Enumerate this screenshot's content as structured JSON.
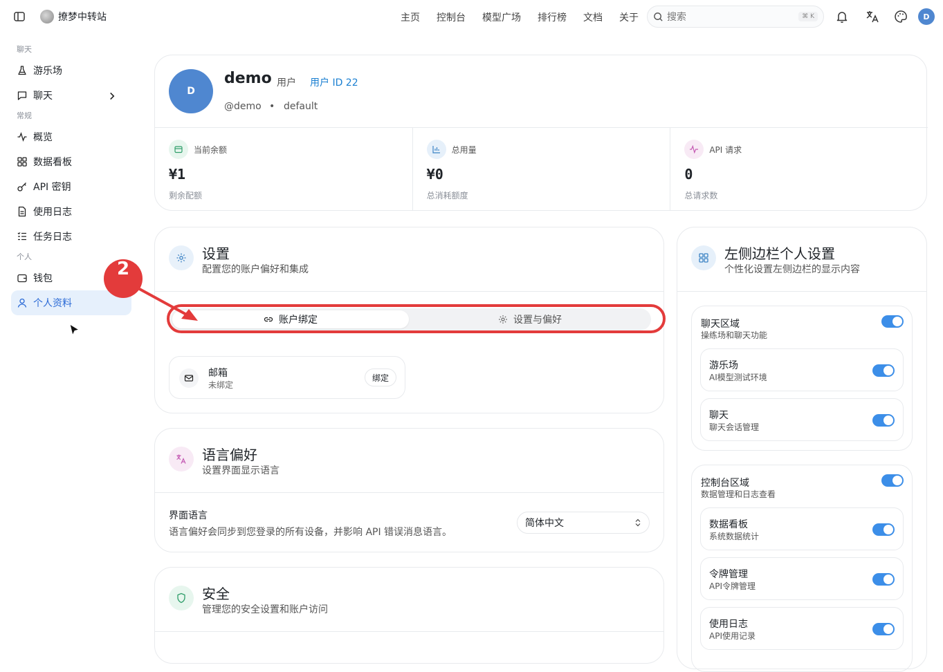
{
  "header": {
    "site_name": "撩梦中转站",
    "nav": [
      "主页",
      "控制台",
      "模型广场",
      "排行榜",
      "文档",
      "关于"
    ],
    "search_placeholder": "搜索",
    "search_shortcut": "⌘ K",
    "avatar_initial": "D"
  },
  "sidebar": {
    "groups": [
      {
        "label": "聊天",
        "items": [
          {
            "label": "游乐场",
            "icon": "flask-icon"
          },
          {
            "label": "聊天",
            "icon": "message-icon",
            "has_chevron": true
          }
        ]
      },
      {
        "label": "常规",
        "items": [
          {
            "label": "概览",
            "icon": "activity-icon"
          },
          {
            "label": "数据看板",
            "icon": "grid-icon"
          },
          {
            "label": "API 密钥",
            "icon": "key-icon"
          },
          {
            "label": "使用日志",
            "icon": "file-icon"
          },
          {
            "label": "任务日志",
            "icon": "list-icon"
          }
        ]
      },
      {
        "label": "个人",
        "items": [
          {
            "label": "钱包",
            "icon": "wallet-icon"
          },
          {
            "label": "个人资料",
            "icon": "user-icon",
            "active": true
          }
        ]
      }
    ]
  },
  "profile": {
    "avatar_initial": "D",
    "name": "demo",
    "role": "用户",
    "user_id": "用户 ID 22",
    "handle": "@demo",
    "separator": "•",
    "group": "default",
    "stats": [
      {
        "label": "当前余额",
        "value": "¥1",
        "sub": "剩余配额",
        "icon": "wallet-icon",
        "color": "#2f9e6a",
        "bg": "#e7f6ee"
      },
      {
        "label": "总用量",
        "value": "¥0",
        "sub": "总消耗额度",
        "icon": "bar-chart-icon",
        "color": "#3b82c4",
        "bg": "#e6f0fa"
      },
      {
        "label": "API 请求",
        "value": "0",
        "sub": "总请求数",
        "icon": "activity-icon",
        "color": "#c45ab3",
        "bg": "#f8eaf5"
      }
    ]
  },
  "settings": {
    "title": "设置",
    "subtitle": "配置您的账户偏好和集成",
    "tabs": [
      {
        "label": "账户绑定",
        "active": true
      },
      {
        "label": "设置与偏好",
        "active": false
      }
    ],
    "bindings": [
      {
        "name": "邮箱",
        "status": "未绑定",
        "action": "绑定"
      }
    ]
  },
  "language": {
    "title": "语言偏好",
    "subtitle": "设置界面显示语言",
    "label": "界面语言",
    "description": "语言偏好会同步到您登录的所有设备，并影响 API 错误消息语言。",
    "selected": "简体中文"
  },
  "security": {
    "title": "安全",
    "subtitle": "管理您的安全设置和账户访问"
  },
  "sidebar_settings": {
    "title": "左侧边栏个人设置",
    "subtitle": "个性化设置左侧边栏的显示内容",
    "sections": [
      {
        "title": "聊天区域",
        "sub": "操练场和聊天功能",
        "enabled": true,
        "items": [
          {
            "title": "游乐场",
            "sub": "AI模型测试环境",
            "enabled": true
          },
          {
            "title": "聊天",
            "sub": "聊天会话管理",
            "enabled": true
          }
        ]
      },
      {
        "title": "控制台区域",
        "sub": "数据管理和日志查看",
        "enabled": true,
        "items": [
          {
            "title": "数据看板",
            "sub": "系统数据统计",
            "enabled": true
          },
          {
            "title": "令牌管理",
            "sub": "API令牌管理",
            "enabled": true
          },
          {
            "title": "使用日志",
            "sub": "API使用记录",
            "enabled": true
          }
        ]
      }
    ]
  },
  "annotation": {
    "badge": "2",
    "color": "#e33b3b"
  }
}
